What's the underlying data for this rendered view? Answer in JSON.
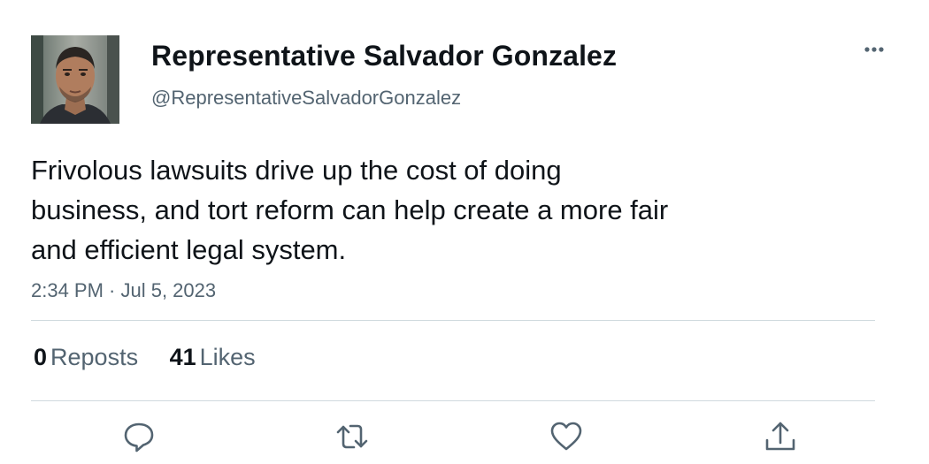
{
  "author": {
    "display_name": "Representative Salvador Gonzalez",
    "handle": "@RepresentativeSalvadorGonzalez"
  },
  "tweet": {
    "text_lines": [
      "Frivolous lawsuits drive up the cost of doing",
      "business, and tort reform can help create a more fair",
      "and efficient legal system."
    ],
    "timestamp": "2:34 PM · Jul 5, 2023"
  },
  "stats": {
    "reposts_count": "0",
    "reposts_label": "Reposts",
    "likes_count": "41",
    "likes_label": "Likes"
  },
  "actions": [
    "reply-icon",
    "repost-icon",
    "like-icon",
    "share-icon"
  ],
  "colors": {
    "text_primary": "#0f1419",
    "text_secondary": "#536471",
    "divider": "#cfd9de",
    "background": "#ffffff"
  }
}
